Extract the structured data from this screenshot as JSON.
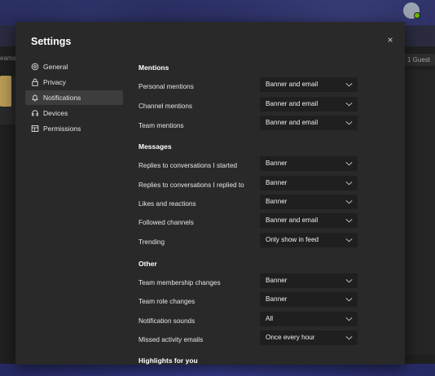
{
  "background": {
    "left_text": "eams",
    "guest_label": "1 Guest"
  },
  "dialog": {
    "title": "Settings",
    "close_glyph": "×"
  },
  "nav": [
    {
      "label": "General",
      "icon": "gear-icon"
    },
    {
      "label": "Privacy",
      "icon": "lock-icon"
    },
    {
      "label": "Notifications",
      "icon": "bell-icon",
      "active": true
    },
    {
      "label": "Devices",
      "icon": "headset-icon"
    },
    {
      "label": "Permissions",
      "icon": "permissions-icon"
    }
  ],
  "sections": {
    "mentions": {
      "heading": "Mentions",
      "rows": [
        {
          "label": "Personal mentions",
          "value": "Banner and email"
        },
        {
          "label": "Channel mentions",
          "value": "Banner and email"
        },
        {
          "label": "Team mentions",
          "value": "Banner and email"
        }
      ]
    },
    "messages": {
      "heading": "Messages",
      "rows": [
        {
          "label": "Replies to conversations I started",
          "value": "Banner"
        },
        {
          "label": "Replies to conversations I replied to",
          "value": "Banner"
        },
        {
          "label": "Likes and reactions",
          "value": "Banner"
        },
        {
          "label": "Followed channels",
          "value": "Banner and email"
        },
        {
          "label": "Trending",
          "value": "Only show in feed"
        }
      ]
    },
    "other": {
      "heading": "Other",
      "rows": [
        {
          "label": "Team membership changes",
          "value": "Banner"
        },
        {
          "label": "Team role changes",
          "value": "Banner"
        },
        {
          "label": "Notification sounds",
          "value": "All"
        },
        {
          "label": "Missed activity emails",
          "value": "Once every hour"
        }
      ]
    },
    "highlights": {
      "heading": "Highlights for you"
    }
  },
  "colors": {
    "dialog_bg": "#292929",
    "select_bg": "#1f1f1f",
    "active_nav_bg": "#3d3d3d",
    "text": "#ffffff"
  }
}
